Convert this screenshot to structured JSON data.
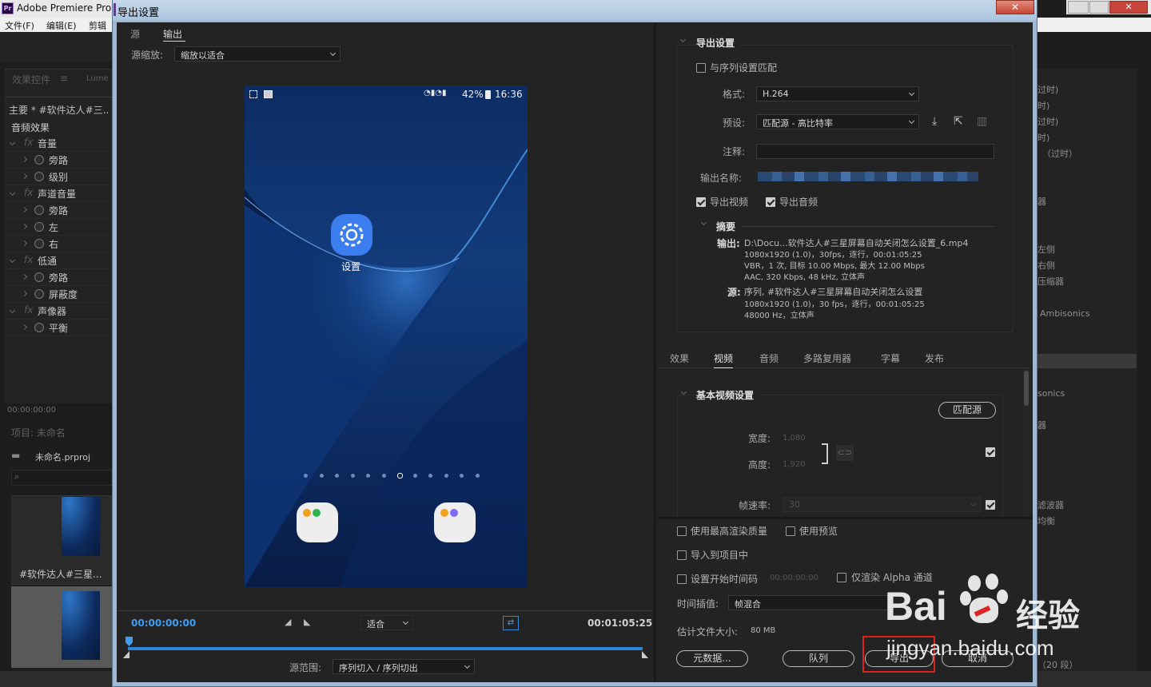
{
  "app": {
    "title": "Adobe Premiere Pro",
    "menu": [
      "文件(F)",
      "编辑(E)",
      "剪辑"
    ]
  },
  "left_panel": {
    "tab": "效果控件",
    "tab2": "Lume",
    "clip": "主要 * #软件达人#三...",
    "audio_effects": "音频效果",
    "rows": [
      {
        "label": "音量",
        "fx": true,
        "level": 0
      },
      {
        "label": "旁路",
        "level": 1
      },
      {
        "label": "级别",
        "level": 1
      },
      {
        "label": "声道音量",
        "fx": true,
        "level": 0
      },
      {
        "label": "旁路",
        "level": 1
      },
      {
        "label": "左",
        "level": 1
      },
      {
        "label": "右",
        "level": 1
      },
      {
        "label": "低通",
        "fx": true,
        "level": 0
      },
      {
        "label": "旁路",
        "level": 1
      },
      {
        "label": "屏蔽度",
        "level": 1
      },
      {
        "label": "声像器",
        "fx": true,
        "level": 0
      },
      {
        "label": "平衡",
        "level": 1
      }
    ],
    "timecode": "00:00:00:00",
    "project_title": "项目: 未命名",
    "project_file": "未命名.prproj",
    "clip_name": "#软件达人#三星..."
  },
  "right_bg": {
    "items": [
      "过时)",
      "时)",
      "过时)",
      "时)",
      "（过时）",
      "器",
      "左侧",
      "右侧",
      "压缩器",
      "Ambisonics",
      "sonics",
      "器",
      "滤波器",
      "均衡",
      "（20 段）"
    ]
  },
  "dialog": {
    "title": "导出设置",
    "close": "✕",
    "tabs": [
      "源",
      "输出"
    ],
    "source_scale_label": "源缩放:",
    "source_scale_value": "缩放以适合",
    "phone": {
      "battery": "42%",
      "time": "16:36",
      "settings_label": "设置"
    },
    "timeline": {
      "start": "00:00:00:00",
      "end": "00:01:05:25",
      "fit": "适合",
      "progress": 1.0
    },
    "source_range_label": "源范围:",
    "source_range_value": "序列切入 / 序列切出",
    "export_settings": {
      "header": "导出设置",
      "match_sequence": "与序列设置匹配",
      "format_label": "格式:",
      "format_value": "H.264",
      "preset_label": "预设:",
      "preset_value": "匹配源 - 高比特率",
      "comment_label": "注释:",
      "output_name_label": "输出名称:",
      "export_video": "导出视频",
      "export_audio": "导出音频"
    },
    "summary": {
      "header": "摘要",
      "output_label": "输出:",
      "output_lines": [
        "D:\\Docu...软件达人#三星屏幕自动关闭怎么设置_6.mp4",
        "1080x1920 (1.0)，30fps，逐行，00:01:05:25",
        "VBR，1 次, 目标 10.00 Mbps, 最大 12.00 Mbps",
        "AAC, 320 Kbps, 48  kHz, 立体声"
      ],
      "source_label": "源:",
      "source_lines": [
        "序列, #软件达人#三星屏幕自动关闭怎么设置",
        "1080x1920 (1.0)，30 fps，逐行，00:01:05:25",
        "48000 Hz，立体声"
      ]
    },
    "settings_tabs": [
      "效果",
      "视频",
      "音频",
      "多路复用器",
      "字幕",
      "发布"
    ],
    "active_tab": "视频",
    "basic_video": {
      "header": "基本视频设置",
      "match_source": "匹配源",
      "width_label": "宽度:",
      "width_value": "1,080",
      "height_label": "高度:",
      "height_value": "1,920",
      "framerate_label": "帧速率:",
      "framerate_value": "30"
    },
    "bottom": {
      "max_render": "使用最高渲染质量",
      "use_preview": "使用预览",
      "import_project": "导入到项目中",
      "set_start_tc": "设置开始时间码",
      "start_tc": "00:00:00:00",
      "alpha_only": "仅渲染 Alpha 通道",
      "interp_label": "时间插值:",
      "interp_value": "帧混合",
      "filesize_label": "估计文件大小:",
      "filesize_value": "80 MB",
      "metadata_btn": "元数据...",
      "queue_btn": "队列",
      "export_btn": "导出",
      "cancel_btn": "取消"
    }
  },
  "watermark": {
    "brand": "Bai",
    "suffix": "经验",
    "url": "jingyan.baidu.com"
  }
}
